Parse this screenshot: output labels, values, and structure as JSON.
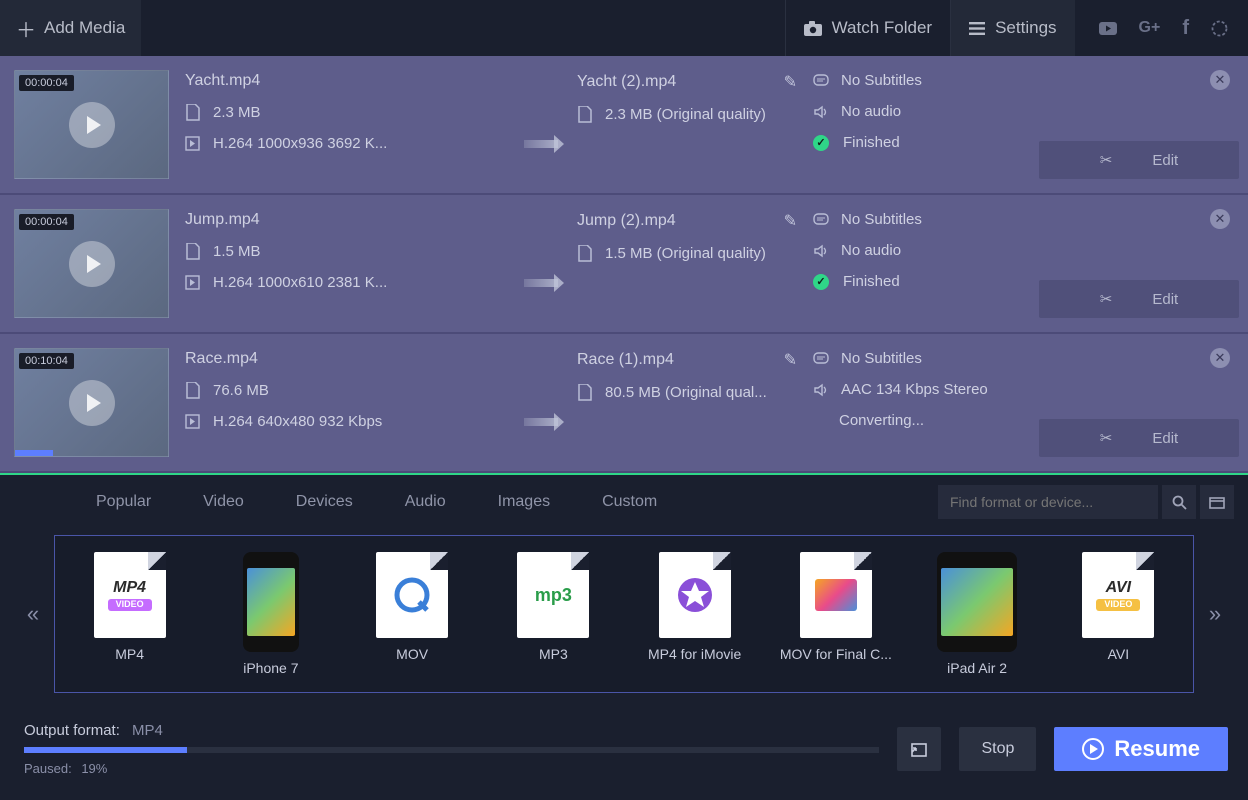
{
  "topbar": {
    "add_media": "Add Media",
    "watch_folder": "Watch Folder",
    "settings": "Settings"
  },
  "media": [
    {
      "duration": "00:00:04",
      "name": "Yacht.mp4",
      "size": "2.3 MB",
      "codec": "H.264 1000x936 3692 K...",
      "out_name": "Yacht (2).mp4",
      "out_size": "2.3 MB (Original quality)",
      "subtitles": "No Subtitles",
      "audio": "No audio",
      "status": "Finished",
      "status_icon": "check",
      "edit": "Edit",
      "progress_pct": 0
    },
    {
      "duration": "00:00:04",
      "name": "Jump.mp4",
      "size": "1.5 MB",
      "codec": "H.264 1000x610 2381 K...",
      "out_name": "Jump (2).mp4",
      "out_size": "1.5 MB (Original quality)",
      "subtitles": "No Subtitles",
      "audio": "No audio",
      "status": "Finished",
      "status_icon": "check",
      "edit": "Edit",
      "progress_pct": 0
    },
    {
      "duration": "00:10:04",
      "name": "Race.mp4",
      "size": "76.6 MB",
      "codec": "H.264 640x480 932 Kbps",
      "out_name": "Race (1).mp4",
      "out_size": "80.5 MB (Original qual...",
      "subtitles": "No Subtitles",
      "audio": "AAC 134 Kbps Stereo",
      "status": "Converting...",
      "status_icon": "none",
      "edit": "Edit",
      "progress_pct": 25
    }
  ],
  "format_tabs": [
    "Popular",
    "Video",
    "Devices",
    "Audio",
    "Images",
    "Custom"
  ],
  "search_placeholder": "Find format or device...",
  "formats": [
    {
      "label": "MP4",
      "badge": "MP4",
      "sub": "VIDEO",
      "kind": "file",
      "color": "#c56cff"
    },
    {
      "label": "iPhone 7",
      "kind": "phone"
    },
    {
      "label": "MOV",
      "badge": "Q",
      "kind": "file",
      "qt": true
    },
    {
      "label": "MP3",
      "badge": "mp3",
      "kind": "file",
      "mp3": true
    },
    {
      "label": "MP4 for iMovie",
      "kind": "file",
      "star": true
    },
    {
      "label": "MOV for Final C...",
      "kind": "file",
      "fcp": true
    },
    {
      "label": "iPad Air 2",
      "kind": "tablet"
    },
    {
      "label": "AVI",
      "badge": "AVI",
      "sub": "VIDEO",
      "kind": "file",
      "color": "#f5c043"
    }
  ],
  "output": {
    "label": "Output format:",
    "value": "MP4",
    "paused": "Paused:",
    "paused_pct": "19%",
    "progress_pct": 19
  },
  "buttons": {
    "stop": "Stop",
    "resume": "Resume"
  }
}
